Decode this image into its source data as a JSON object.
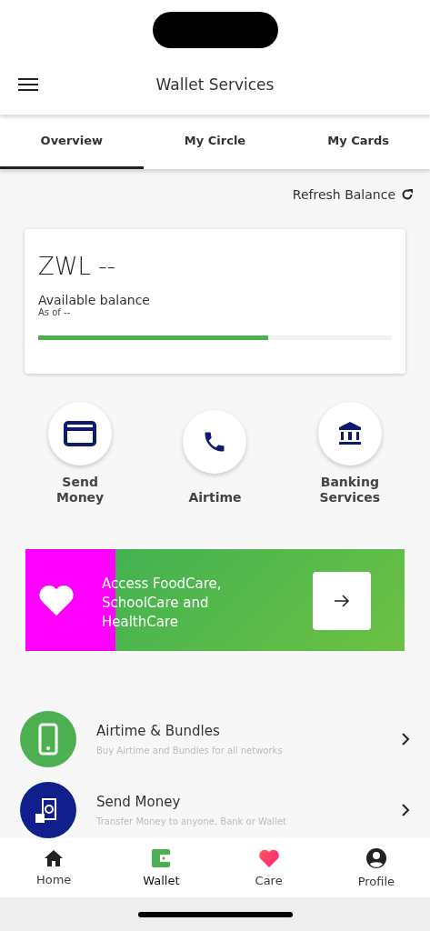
{
  "header": {
    "title": "Wallet Services"
  },
  "tabs": [
    {
      "label": "Overview",
      "selected": true
    },
    {
      "label": "My Circle",
      "selected": false
    },
    {
      "label": "My Cards",
      "selected": false
    }
  ],
  "refresh": {
    "label": "Refresh Balance"
  },
  "balance": {
    "amount": "ZWL --",
    "label": "Available balance",
    "as_of": "As of --",
    "level": 0.65
  },
  "quick_actions": [
    {
      "kind": "card",
      "label": "Send Money"
    },
    {
      "kind": "phone",
      "label": "Airtime"
    },
    {
      "kind": "bank",
      "label": "Banking Services"
    }
  ],
  "promo": {
    "text": "Access FoodCare, SchoolCare and HealthCare"
  },
  "services": [
    {
      "kind": "phone",
      "title": "Airtime & Bundles",
      "subtitle": "Buy Airtime and Bundles for all networks"
    },
    {
      "kind": "money",
      "title": "Send Money",
      "subtitle": "Transfer Money to anyone, Bank or Wallet"
    }
  ],
  "nav": [
    {
      "kind": "home",
      "label": "Home",
      "selected": false
    },
    {
      "kind": "wallet",
      "label": "Wallet",
      "selected": true
    },
    {
      "kind": "care",
      "label": "Care",
      "selected": false
    },
    {
      "kind": "profile",
      "label": "Profile",
      "selected": false
    }
  ]
}
